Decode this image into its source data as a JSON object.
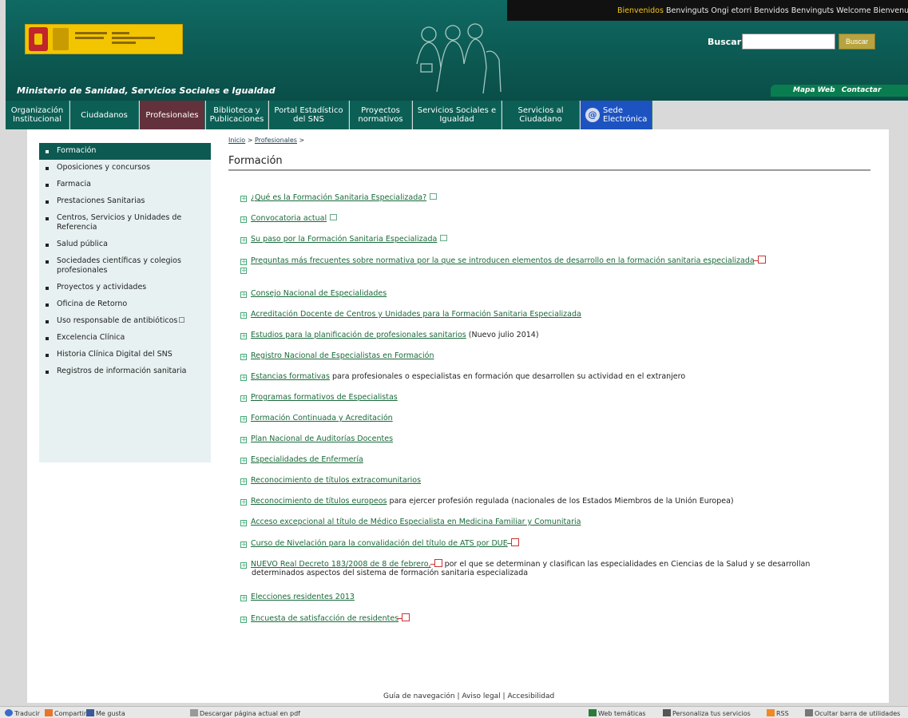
{
  "header": {
    "lang_welcome": "Bienvenidos",
    "lang_links": "Benvinguts Ongi etorri Benvidos Benvinguts Welcome Bienvenue",
    "ministry": "Ministerio de Sanidad, Servicios Sociales e Igualdad",
    "search_label": "Buscar",
    "search_button": "Buscar",
    "util_links": [
      "Mapa Web",
      "Contactar"
    ]
  },
  "nav": [
    {
      "label": "Organización Institucional"
    },
    {
      "label": "Ciudadanos"
    },
    {
      "label": "Profesionales"
    },
    {
      "label": "Biblioteca y Publicaciones"
    },
    {
      "label": "Portal Estadístico del SNS"
    },
    {
      "label": "Proyectos normativos"
    },
    {
      "label": "Servicios Sociales e Igualdad"
    },
    {
      "label": "Servicios al Ciudadano"
    },
    {
      "label": "Sede Electrónica"
    }
  ],
  "sidebar": [
    "Formación",
    "Oposiciones y concursos",
    "Farmacia",
    "Prestaciones Sanitarias",
    "Centros, Servicios y Unidades de Referencia",
    "Salud pública",
    "Sociedades científicas y colegios profesionales",
    "Proyectos y actividades",
    "Oficina de Retorno",
    "Uso responsable de antibióticos",
    "Excelencia Clínica",
    "Historia Clínica Digital del SNS",
    "Registros de información sanitaria"
  ],
  "breadcrumb": {
    "home": "Inicio",
    "section": "Profesionales"
  },
  "page_title": "Formación",
  "items": [
    {
      "link": "¿Qué es la Formación Sanitaria Especializada?",
      "after": ""
    },
    {
      "link": "Convocatoria actual",
      "after": ""
    },
    {
      "link": "Su paso por la Formación Sanitaria Especializada",
      "after": ""
    },
    {
      "link": "Preguntas más frecuentes sobre normativa por la que se introducen elementos de desarrollo en la formación sanitaria especializada",
      "after": ""
    },
    {
      "link": "Consejo Nacional de Especialidades",
      "after": ""
    },
    {
      "link": "Acreditación Docente de Centros y Unidades para la Formación Sanitaria Especializada",
      "after": ""
    },
    {
      "link": "Estudios para la planificación de profesionales sanitarios",
      "after": "(Nuevo julio 2014)"
    },
    {
      "link": "Registro Nacional de Especialistas en Formación",
      "after": ""
    },
    {
      "link": "Estancias formativas",
      "after": "para profesionales o especialistas en formación que desarrollen su actividad en el extranjero"
    },
    {
      "link": "Programas formativos de Especialistas",
      "after": ""
    },
    {
      "link": "Formación Continuada y Acreditación",
      "after": ""
    },
    {
      "link": "Plan Nacional de Auditorías Docentes",
      "after": ""
    },
    {
      "link": "Especialidades de Enfermería",
      "after": ""
    },
    {
      "link": "Reconocimiento de títulos extracomunitarios",
      "after": ""
    },
    {
      "link": "Reconocimiento de títulos europeos",
      "after": "para ejercer profesión regulada (nacionales de los Estados Miembros de la Unión Europea)"
    },
    {
      "link": "Acceso excepcional al título de Médico Especialista en Medicina Familiar y Comunitaria",
      "after": ""
    },
    {
      "link": "Curso de Nivelación para la convalidación del título de ATS por DUE",
      "after": ""
    },
    {
      "link": "NUEVO Real Decreto 183/2008 de 8 de febrero,",
      "after": "por el que se determinan y clasifican las especialidades en Ciencias de la Salud y se desarrollan",
      "sub": "determinados aspectos del sistema de formación sanitaria especializada"
    },
    {
      "link": "Elecciones residentes 2013",
      "after": ""
    },
    {
      "link": "Encuesta de satisfacción de residentes",
      "after": ""
    }
  ],
  "footer": {
    "links": [
      "Guía de navegación",
      "Aviso legal",
      "Accesibilidad"
    ]
  },
  "toolbar": {
    "left": [
      "Traducir",
      "Compartir",
      "Me gusta",
      "Descargar página actual en pdf"
    ],
    "right": [
      "Web temáticas",
      "Personaliza tus servicios",
      "RSS",
      "Ocultar barra de utilidades"
    ]
  },
  "colors": {
    "header": "#0c5a53",
    "active_tab": "#63313b",
    "sede": "#1d53c0",
    "link": "#1a6a3a"
  }
}
